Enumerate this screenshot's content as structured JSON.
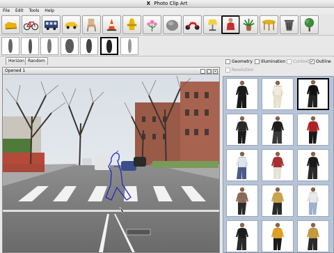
{
  "window": {
    "title": "Photo Clip Art",
    "close_glyph": "X"
  },
  "menu": [
    "File",
    "Edit",
    "Tools",
    "Help"
  ],
  "categories": [
    {
      "icon": "sofa-icon",
      "selected": false
    },
    {
      "icon": "bicycle-icon",
      "selected": false
    },
    {
      "icon": "bus-icon",
      "selected": false
    },
    {
      "icon": "car-icon",
      "selected": false
    },
    {
      "icon": "chair-icon",
      "selected": false
    },
    {
      "icon": "traffic-cone-icon",
      "selected": false
    },
    {
      "icon": "fire-hydrant-icon",
      "selected": false
    },
    {
      "icon": "flower-icon",
      "selected": false
    },
    {
      "icon": "rock-icon",
      "selected": false
    },
    {
      "icon": "motorcycle-icon",
      "selected": false
    },
    {
      "icon": "lamp-icon",
      "selected": false
    },
    {
      "icon": "person-icon",
      "selected": true
    },
    {
      "icon": "potted-plant-icon",
      "selected": false
    },
    {
      "icon": "table-icon",
      "selected": false
    },
    {
      "icon": "trash-can-icon",
      "selected": false
    },
    {
      "icon": "tree-icon",
      "selected": false
    }
  ],
  "variants": [
    {
      "selected": false
    },
    {
      "selected": false
    },
    {
      "selected": false
    },
    {
      "selected": false
    },
    {
      "selected": false
    },
    {
      "selected": true
    },
    {
      "selected": false
    }
  ],
  "tabs": [
    "Horizon",
    "Random"
  ],
  "document": {
    "title": "Opened 1"
  },
  "options": {
    "geometry": {
      "label": "Geometry",
      "checked": false,
      "enabled": true
    },
    "illumination": {
      "label": "Illumination",
      "checked": false,
      "enabled": true
    },
    "context": {
      "label": "Context",
      "checked": false,
      "enabled": false
    },
    "outline": {
      "label": "Outline",
      "checked": true,
      "enabled": true
    },
    "resolution": {
      "label": "Resolution",
      "checked": false,
      "enabled": false
    }
  },
  "gallery": {
    "selected_index": 2,
    "items": [
      {
        "shirt": "#1a1a1a",
        "pants": "#1a1a1a"
      },
      {
        "shirt": "#f2ebdc",
        "pants": "#e8e0cc"
      },
      {
        "shirt": "#111111",
        "pants": "#222222"
      },
      {
        "shirt": "#2a2a2a",
        "pants": "#1b1b1b"
      },
      {
        "shirt": "#1e1e1e",
        "pants": "#3a3a3a"
      },
      {
        "shirt": "#b02020",
        "pants": "#1a1a1a"
      },
      {
        "shirt": "#dfe4ef",
        "pants": "#4a5a8a"
      },
      {
        "shirt": "#a83030",
        "pants": "#e6e0d4"
      },
      {
        "shirt": "#1a1a1a",
        "pants": "#2a2a2a"
      },
      {
        "shirt": "#8a6a58",
        "pants": "#2a2a2a"
      },
      {
        "shirt": "#c9a44a",
        "pants": "#2a2a2a"
      },
      {
        "shirt": "#e9e9e9",
        "pants": "#9db0cf"
      },
      {
        "shirt": "#1c1c1c",
        "pants": "#2a2a2a"
      },
      {
        "shirt": "#e0a020",
        "pants": "#1a1a1a"
      },
      {
        "shirt": "#c69a3a",
        "pants": "#2a2a2a"
      }
    ]
  }
}
